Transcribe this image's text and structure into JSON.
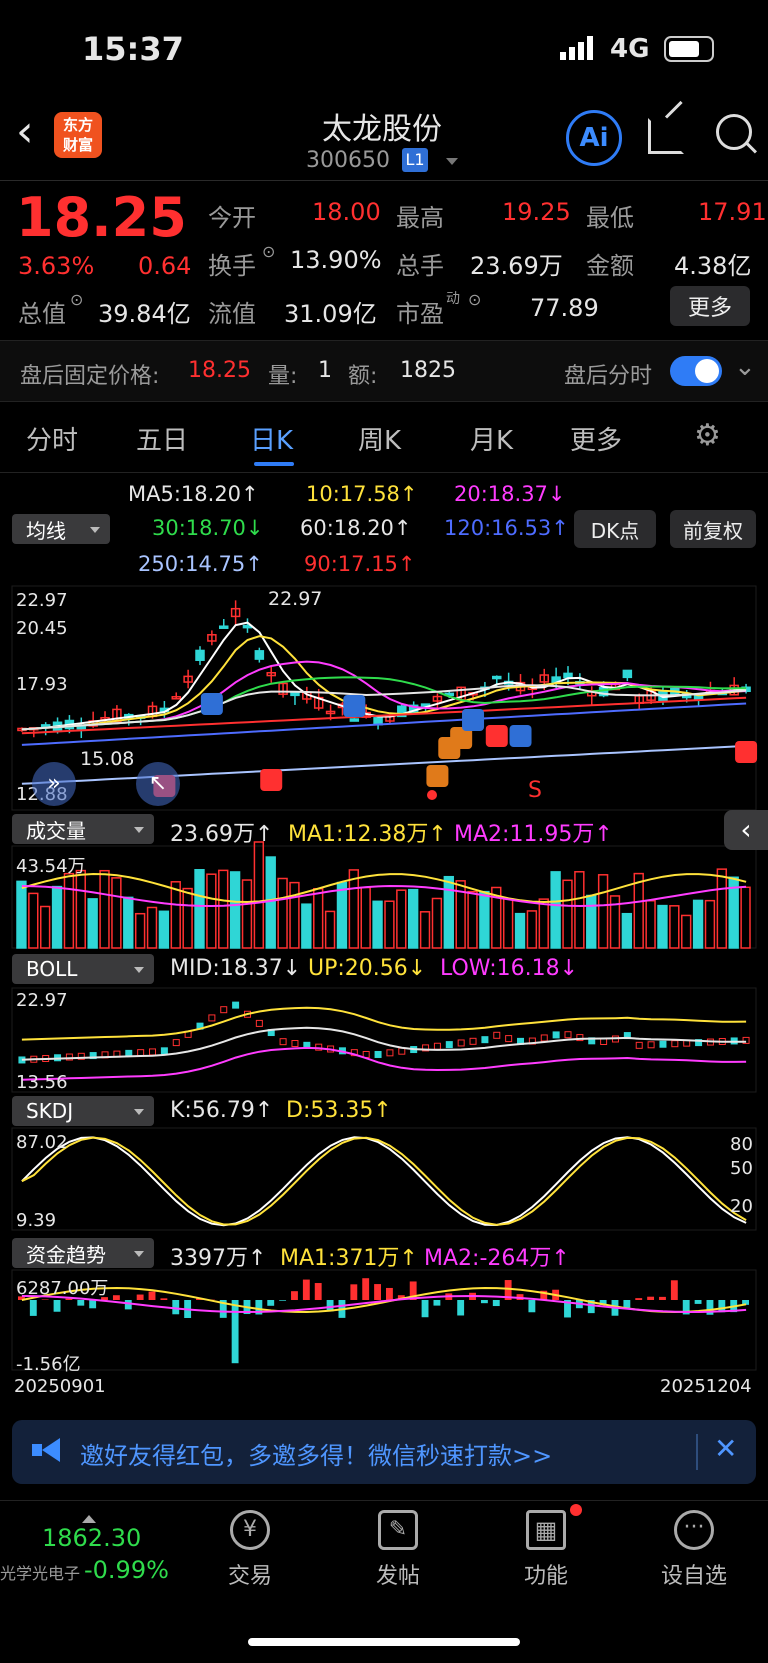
{
  "status_bar": {
    "time": "15:37",
    "network": "4G"
  },
  "header": {
    "logo_text_1": "东方",
    "logo_text_2": "财富",
    "stock_name": "太龙股份",
    "stock_code": "300650",
    "level_badge": "L1",
    "ai_label": "Ai"
  },
  "quote": {
    "price": "18.25",
    "change_pct": "3.63%",
    "change_amt": "0.64",
    "open_label": "今开",
    "open": "18.00",
    "high_label": "最高",
    "high": "19.25",
    "low_label": "最低",
    "low": "17.91",
    "turnover_label": "换手",
    "turnover": "13.90%",
    "volume_label": "总手",
    "volume": "23.69万",
    "amount_label": "金额",
    "amount": "4.38亿",
    "mktcap_label": "总值",
    "mktcap": "39.84亿",
    "float_label": "流值",
    "float": "31.09亿",
    "pe_label": "市盈",
    "pe_sup": "动",
    "pe": "77.89",
    "more_button": "更多"
  },
  "after_hours": {
    "label": "盘后固定价格:",
    "price": "18.25",
    "vol_label": "量:",
    "vol": "1",
    "amt_label": "额:",
    "amt": "1825",
    "toggle_label": "盘后分时",
    "toggle_on": true
  },
  "tabs": [
    "分时",
    "五日",
    "日K",
    "周K",
    "月K",
    "更多"
  ],
  "active_tab": "日K",
  "ma_legend": {
    "selector": "均线",
    "ma5": "MA5:18.20↑",
    "ma10": "10:17.58↑",
    "ma20": "20:18.37↓",
    "ma30": "30:18.70↓",
    "ma60": "60:18.20↑",
    "ma120": "120:16.53↑",
    "ma250": "250:14.75↑",
    "ma90": "90:17.15↑",
    "dk_button": "DK点",
    "fq_button": "前复权"
  },
  "kline": {
    "y_high": "22.97",
    "y_2": "20.45",
    "y_3": "17.93",
    "y_low": "12.88",
    "peak_label": "22.97",
    "low_label": "15.08",
    "signals": [
      "S",
      "B",
      "S",
      "T",
      "T",
      "B",
      "S",
      "B",
      "S",
      "T",
      "B"
    ],
    "signal_s_red": "S"
  },
  "volume_panel": {
    "selector": "成交量",
    "vol": "23.69万↑",
    "ma1": "MA1:12.38万↑",
    "ma2": "MA2:11.95万↑",
    "y_max": "43.54万"
  },
  "boll_panel": {
    "selector": "BOLL",
    "mid": "MID:18.37↓",
    "up": "UP:20.56↓",
    "low": "LOW:16.18↓",
    "y_max": "22.97",
    "y_min": "13.56"
  },
  "skdj_panel": {
    "selector": "SKDJ",
    "k": "K:56.79↑",
    "d": "D:53.35↑",
    "y_max": "87.02",
    "y_min": "9.39",
    "lvl80": "80",
    "lvl50": "50",
    "lvl20": "20"
  },
  "fund_panel": {
    "selector": "资金趋势",
    "val": "3397万↑",
    "ma1": "MA1:371万↑",
    "ma2": "MA2:-264万↑",
    "y_max": "6287.00万",
    "y_min": "-1.56亿",
    "date_start": "20250901",
    "date_end": "20251204"
  },
  "banner": {
    "text": "邀好友得红包，多邀多得！微信秒速打款>>"
  },
  "bottom_nav": {
    "index_value": "1862.30",
    "index_name": "光学光电子",
    "index_change": "-0.99%",
    "trade": "交易",
    "post": "发帖",
    "func": "功能",
    "watch": "设自选"
  },
  "colors": {
    "up": "#ff3030",
    "down": "#2fd6d6",
    "ma5": "#ffffff",
    "ma10": "#ffe23b",
    "ma20": "#ff3cff",
    "accent": "#2f7cf6"
  }
}
